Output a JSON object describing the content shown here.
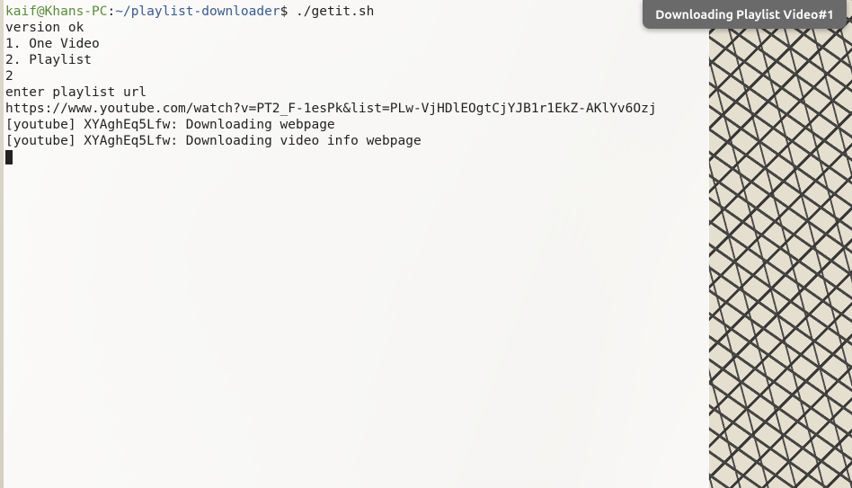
{
  "prompt": {
    "user_host": "kaif@Khans-PC",
    "sep1": ":",
    "path": "~/playlist-downloader",
    "sep2": "$ ",
    "command": "./getit.sh"
  },
  "terminal_output": [
    "version ok",
    "1. One Video",
    "2. Playlist",
    "2",
    "enter playlist url",
    "https://www.youtube.com/watch?v=PT2_F-1esPk&list=PLw-VjHDlEOgtCjYJB1r1EkZ-AKlYv6Ozj",
    "[youtube] XYAghEq5Lfw: Downloading webpage",
    "[youtube] XYAghEq5Lfw: Downloading video info webpage"
  ],
  "notification": {
    "text": "Downloading Playlist Video#1"
  }
}
